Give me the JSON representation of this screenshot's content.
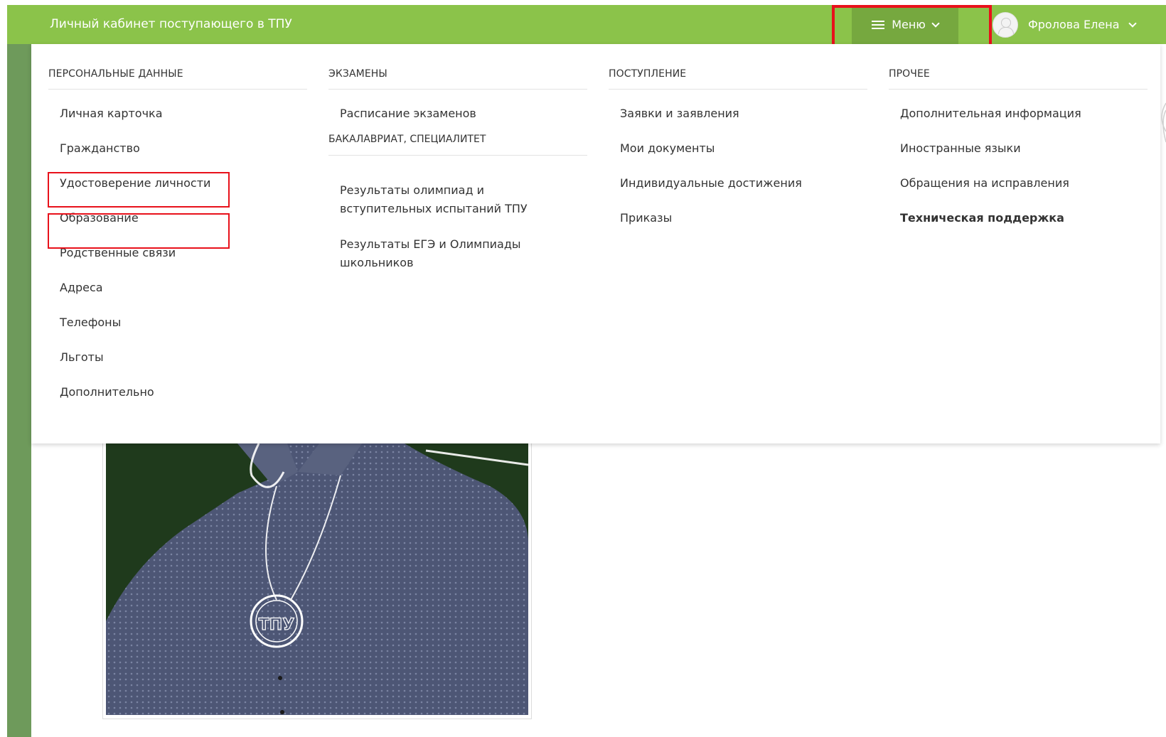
{
  "header": {
    "title": "Личный кабинет поступающего в ТПУ",
    "menu_label": "Меню",
    "user_name": "Фролова Елена"
  },
  "menu": {
    "columns": [
      {
        "heading": "Персональные данные",
        "items": [
          "Личная карточка",
          "Гражданство",
          "Удостоверение личности",
          "Образование",
          "Родственные связи",
          "Адреса",
          "Телефоны",
          "Льготы",
          "Дополнительно"
        ]
      },
      {
        "heading": "Экзамены",
        "items": [
          "Расписание экзаменов"
        ],
        "subheading": "Бакалавриат, специалитет",
        "subitems": [
          "Результаты олимпиад и вступительных испытаний ТПУ",
          "Результаты ЕГЭ и Олимпиады школьников"
        ]
      },
      {
        "heading": "Поступление",
        "items": [
          "Заявки и заявления",
          "Мои документы",
          "Индивидуальные достижения",
          "Приказы"
        ]
      },
      {
        "heading": "Прочее",
        "items": [
          "Дополнительная информация",
          "Иностранные языки",
          "Обращения на исправления",
          "Техническая поддержка"
        ]
      }
    ]
  },
  "photo": {
    "medal_text": "ТПУ"
  },
  "colors": {
    "topbar": "#8bc34a",
    "menu_button": "#76a83f",
    "highlight": "#e8111b",
    "side_stripe": "#6e9a5b"
  }
}
